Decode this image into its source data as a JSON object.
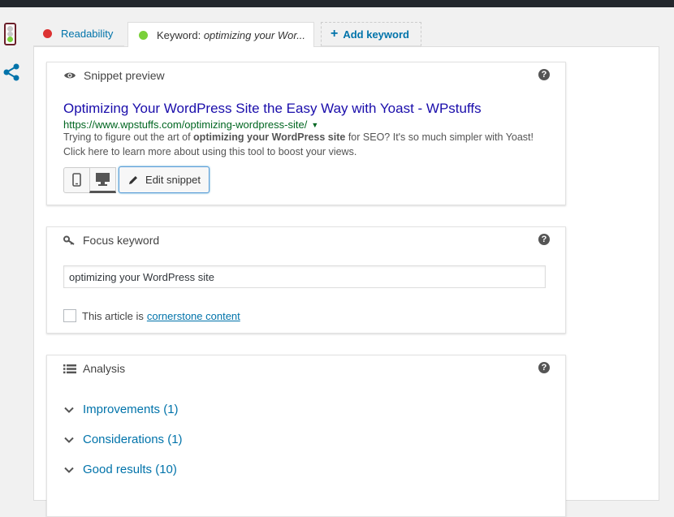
{
  "tabs": {
    "readability": {
      "label": "Readability",
      "status_color": "#dc3232"
    },
    "keyword": {
      "label_prefix": "Keyword: ",
      "keyword_truncated": "optimizing your Wor...",
      "status_color": "#7ad03a"
    },
    "add_keyword": {
      "label": "Add keyword",
      "icon": "plus-icon"
    }
  },
  "sidebar": {
    "icons": [
      "traffic-light-icon",
      "share-icon"
    ]
  },
  "snippet_preview": {
    "heading": "Snippet preview",
    "title": "Optimizing Your WordPress Site the Easy Way with Yoast - WPstuffs",
    "url": "https://www.wpstuffs.com/optimizing-wordpress-site/",
    "desc_before": "Trying to figure out the art of ",
    "desc_bold": "optimizing your WordPress site",
    "desc_after": " for SEO? It's so much simpler with Yoast! Click here to learn more about using this tool to boost your views.",
    "edit_button": "Edit snippet",
    "help": "?"
  },
  "focus_keyword": {
    "heading": "Focus keyword",
    "value": "optimizing your WordPress site",
    "cornerstone_prefix": "This article is",
    "cornerstone_link": "cornerstone content",
    "help": "?"
  },
  "analysis": {
    "heading": "Analysis",
    "help": "?",
    "sections": [
      {
        "label": "Improvements (1)"
      },
      {
        "label": "Considerations (1)"
      },
      {
        "label": "Good results (10)"
      }
    ]
  }
}
